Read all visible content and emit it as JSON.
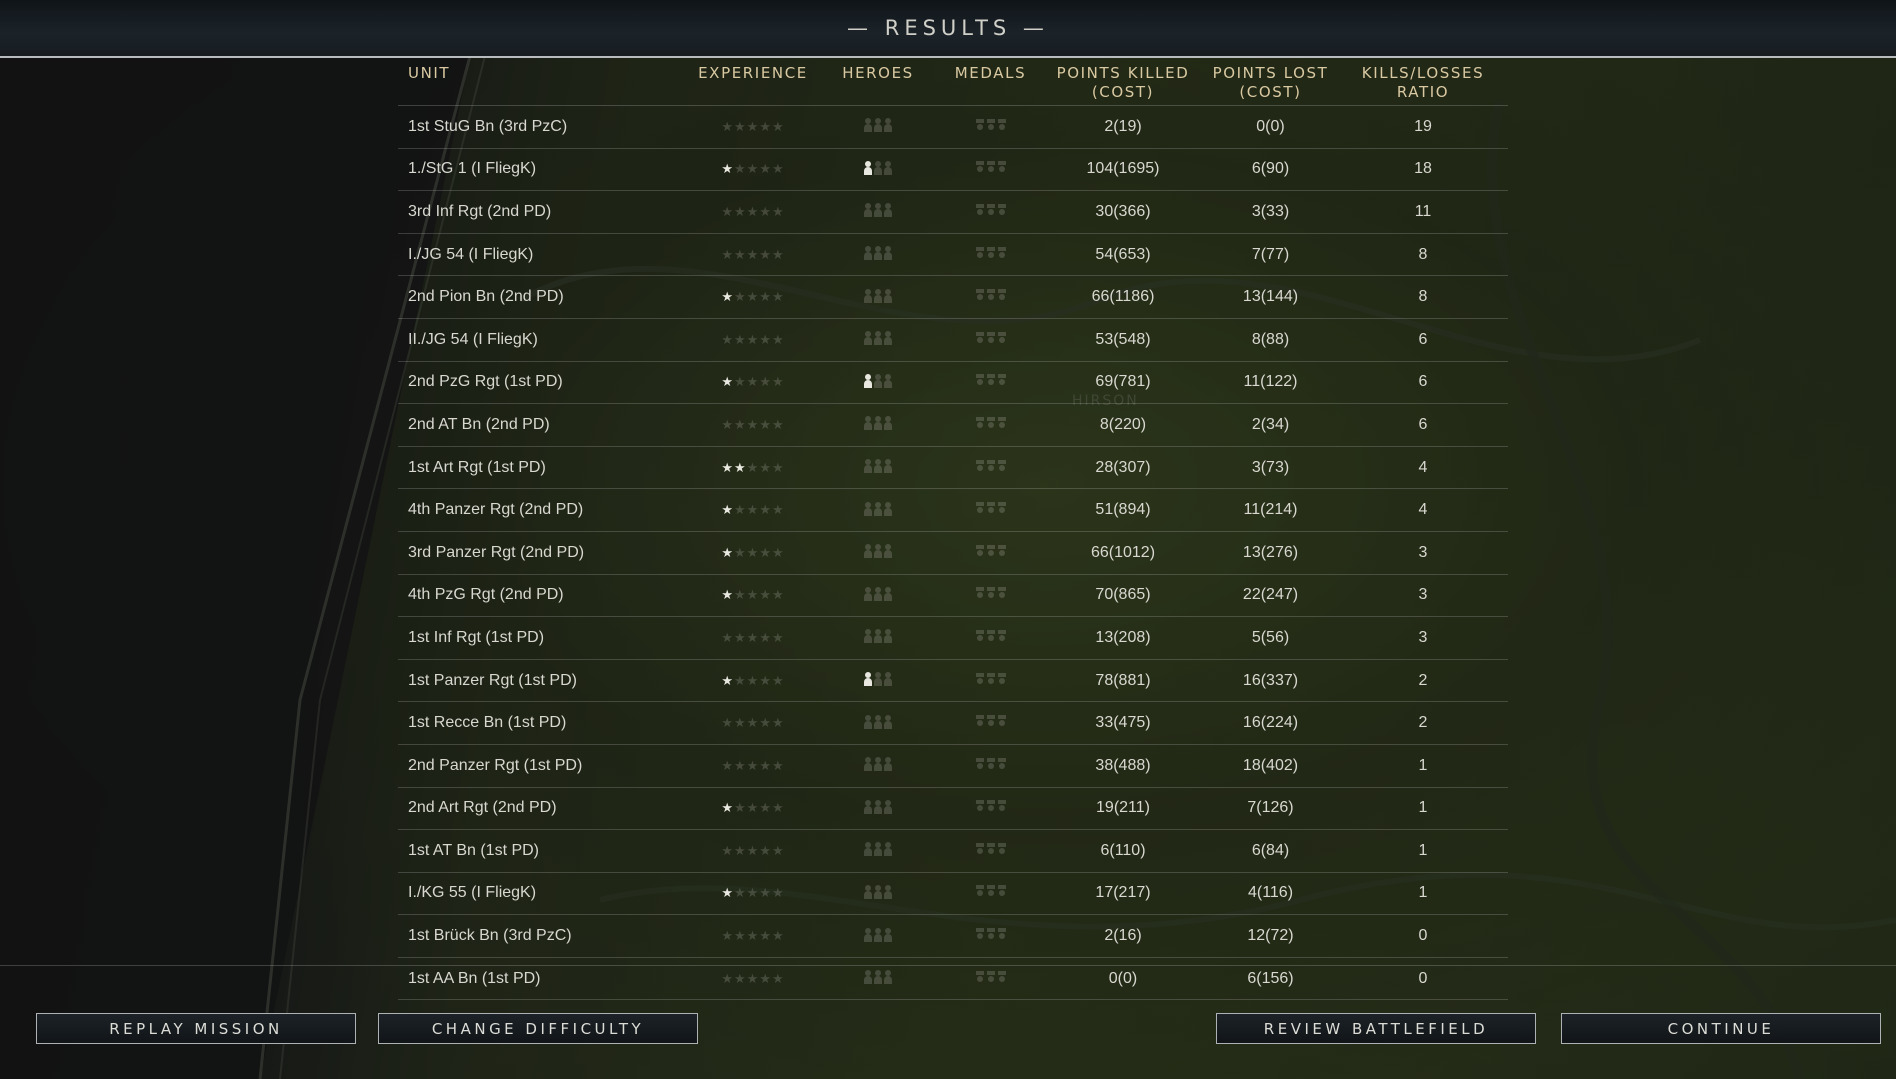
{
  "title": "— RESULTS —",
  "headers": {
    "unit": "UNIT",
    "experience": "EXPERIENCE",
    "heroes": "HEROES",
    "medals": "MEDALS",
    "points_killed": "POINTS KILLED",
    "points_killed_sub": "(COST)",
    "points_lost": "POINTS LOST",
    "points_lost_sub": "(COST)",
    "ratio": "KILLS/LOSSES",
    "ratio_sub": "RATIO"
  },
  "rows": [
    {
      "unit": "1st StuG Bn (3rd PzC)",
      "stars": 0,
      "heroes": 0,
      "medals": 0,
      "killed": "2(19)",
      "lost": "0(0)",
      "ratio": "19"
    },
    {
      "unit": "1./StG 1 (I FliegK)",
      "stars": 1,
      "heroes": 1,
      "medals": 0,
      "killed": "104(1695)",
      "lost": "6(90)",
      "ratio": "18"
    },
    {
      "unit": "3rd Inf Rgt (2nd PD)",
      "stars": 0,
      "heroes": 0,
      "medals": 0,
      "killed": "30(366)",
      "lost": "3(33)",
      "ratio": "11"
    },
    {
      "unit": "I./JG 54 (I FliegK)",
      "stars": 0,
      "heroes": 0,
      "medals": 0,
      "killed": "54(653)",
      "lost": "7(77)",
      "ratio": "8"
    },
    {
      "unit": "2nd Pion Bn (2nd PD)",
      "stars": 1,
      "heroes": 0,
      "medals": 0,
      "killed": "66(1186)",
      "lost": "13(144)",
      "ratio": "8"
    },
    {
      "unit": "II./JG 54 (I FliegK)",
      "stars": 0,
      "heroes": 0,
      "medals": 0,
      "killed": "53(548)",
      "lost": "8(88)",
      "ratio": "6"
    },
    {
      "unit": "2nd PzG Rgt (1st PD)",
      "stars": 1,
      "heroes": 1,
      "medals": 0,
      "killed": "69(781)",
      "lost": "11(122)",
      "ratio": "6"
    },
    {
      "unit": "2nd AT Bn (2nd PD)",
      "stars": 0,
      "heroes": 0,
      "medals": 0,
      "killed": "8(220)",
      "lost": "2(34)",
      "ratio": "6"
    },
    {
      "unit": "1st Art Rgt (1st PD)",
      "stars": 2,
      "heroes": 0,
      "medals": 0,
      "killed": "28(307)",
      "lost": "3(73)",
      "ratio": "4"
    },
    {
      "unit": "4th Panzer Rgt (2nd PD)",
      "stars": 1,
      "heroes": 0,
      "medals": 0,
      "killed": "51(894)",
      "lost": "11(214)",
      "ratio": "4"
    },
    {
      "unit": "3rd Panzer Rgt (2nd PD)",
      "stars": 1,
      "heroes": 0,
      "medals": 0,
      "killed": "66(1012)",
      "lost": "13(276)",
      "ratio": "3"
    },
    {
      "unit": "4th PzG Rgt (2nd PD)",
      "stars": 1,
      "heroes": 0,
      "medals": 0,
      "killed": "70(865)",
      "lost": "22(247)",
      "ratio": "3"
    },
    {
      "unit": "1st Inf Rgt (1st PD)",
      "stars": 0,
      "heroes": 0,
      "medals": 0,
      "killed": "13(208)",
      "lost": "5(56)",
      "ratio": "3"
    },
    {
      "unit": "1st Panzer Rgt (1st PD)",
      "stars": 1,
      "heroes": 1,
      "medals": 0,
      "killed": "78(881)",
      "lost": "16(337)",
      "ratio": "2"
    },
    {
      "unit": "1st Recce Bn (1st PD)",
      "stars": 0,
      "heroes": 0,
      "medals": 0,
      "killed": "33(475)",
      "lost": "16(224)",
      "ratio": "2"
    },
    {
      "unit": "2nd Panzer Rgt (1st PD)",
      "stars": 0,
      "heroes": 0,
      "medals": 0,
      "killed": "38(488)",
      "lost": "18(402)",
      "ratio": "1"
    },
    {
      "unit": "2nd Art Rgt (2nd PD)",
      "stars": 1,
      "heroes": 0,
      "medals": 0,
      "killed": "19(211)",
      "lost": "7(126)",
      "ratio": "1"
    },
    {
      "unit": "1st AT Bn (1st PD)",
      "stars": 0,
      "heroes": 0,
      "medals": 0,
      "killed": "6(110)",
      "lost": "6(84)",
      "ratio": "1"
    },
    {
      "unit": "I./KG 55 (I FliegK)",
      "stars": 1,
      "heroes": 0,
      "medals": 0,
      "killed": "17(217)",
      "lost": "4(116)",
      "ratio": "1"
    },
    {
      "unit": "1st Brück Bn (3rd PzC)",
      "stars": 0,
      "heroes": 0,
      "medals": 0,
      "killed": "2(16)",
      "lost": "12(72)",
      "ratio": "0"
    },
    {
      "unit": "1st AA Bn (1st PD)",
      "stars": 0,
      "heroes": 0,
      "medals": 0,
      "killed": "0(0)",
      "lost": "6(156)",
      "ratio": "0"
    }
  ],
  "map_label": "HIRSON",
  "buttons": {
    "replay": "REPLAY MISSION",
    "difficulty": "CHANGE DIFFICULTY",
    "review": "REVIEW BATTLEFIELD",
    "continue": "CONTINUE"
  }
}
